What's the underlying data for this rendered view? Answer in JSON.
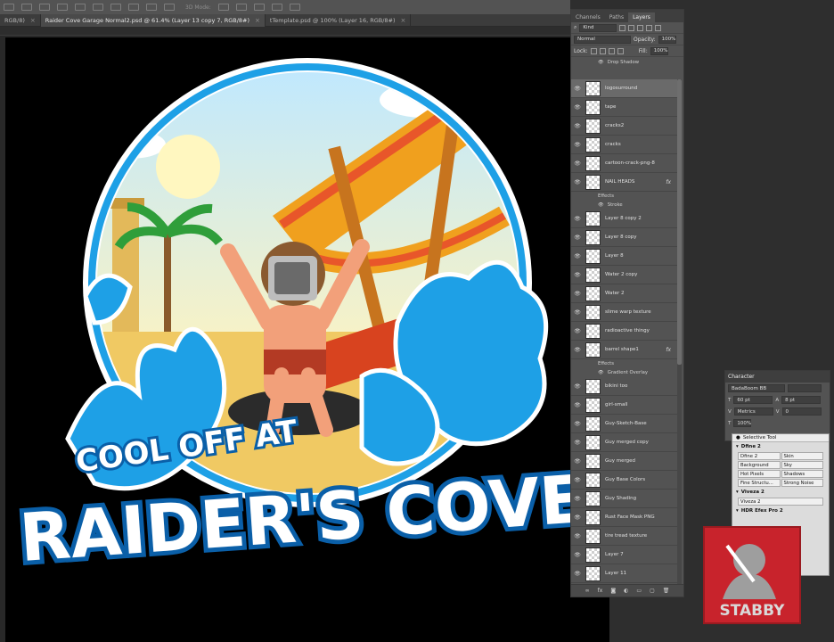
{
  "options_bar": {
    "mode_3d": "3D Mode:"
  },
  "tabs": [
    {
      "label": "RGB/8)",
      "active": false
    },
    {
      "label": "Raider Cove Garage Normal2.psd @ 61.4% (Layer 13 copy 7, RGB/8#)",
      "active": true
    },
    {
      "label": "tTemplate.psd @ 100% (Layer 16, RGB/8#)",
      "active": false
    }
  ],
  "artwork": {
    "line1": "COOL OFF AT",
    "line2": "RAIDER'S COVE"
  },
  "layers_panel": {
    "tabs": [
      "Channels",
      "Paths",
      "Layers"
    ],
    "filter": "Kind",
    "blend_mode": "Normal",
    "opacity_label": "Opacity:",
    "opacity": "100%",
    "lock_label": "Lock:",
    "fill_label": "Fill:",
    "fill": "100%",
    "top_effect": "Drop Shadow",
    "layers": [
      {
        "name": "logosurround",
        "selected": true,
        "fx": false
      },
      {
        "name": "tape",
        "fx": false
      },
      {
        "name": "cracks2",
        "fx": false
      },
      {
        "name": "cracks",
        "fx": false
      },
      {
        "name": "cartoon-crack-png-8",
        "fx": false
      },
      {
        "name": "NAIL HEADS",
        "fx": true,
        "effects": [
          "Effects",
          "Stroke"
        ]
      },
      {
        "name": "Layer 8 copy 2",
        "fx": false
      },
      {
        "name": "Layer 8 copy",
        "fx": false
      },
      {
        "name": "Layer 8",
        "fx": false
      },
      {
        "name": "Water 2 copy",
        "fx": false
      },
      {
        "name": "Water 2",
        "fx": false
      },
      {
        "name": "slime warp texture",
        "fx": false
      },
      {
        "name": "radioactive thingy",
        "fx": false
      },
      {
        "name": "barrel shape1",
        "fx": true,
        "effects": [
          "Effects",
          "Gradient Overlay"
        ]
      },
      {
        "name": "bikini too",
        "fx": false
      },
      {
        "name": "girl-small",
        "fx": false
      },
      {
        "name": "Guy-Sketch-Base",
        "fx": false
      },
      {
        "name": "Guy merged copy",
        "fx": false
      },
      {
        "name": "Guy merged",
        "fx": false
      },
      {
        "name": "Guy Base Colors",
        "fx": false
      },
      {
        "name": "Guy Shading",
        "fx": false
      },
      {
        "name": "Rust Face Mask PNG",
        "fx": false
      },
      {
        "name": "tire tread texture",
        "fx": false
      },
      {
        "name": "Layer 7",
        "fx": false
      },
      {
        "name": "Layer 11",
        "fx": false
      }
    ],
    "fx_label": "fx"
  },
  "character_panel": {
    "title": "Character",
    "font": "BadaBoom BB",
    "size": "60 pt",
    "leading": "8 pt",
    "kerning": "Metrics",
    "tracking": "0",
    "scale_v": "100%"
  },
  "selective_tool": {
    "title": "Selective Tool",
    "sections": [
      {
        "name": "Dfine 2",
        "buttons": [
          "Dfine 2",
          "Skin",
          "Background",
          "Sky",
          "Hot Pixels",
          "Shadows",
          "Fine Structu...",
          "Strong Noise"
        ]
      },
      {
        "name": "Viveza 2",
        "buttons": [
          "Viveza 2"
        ]
      },
      {
        "name": "HDR Efex Pro 2",
        "buttons": []
      }
    ]
  },
  "logo": {
    "text": "STABBY"
  },
  "colors": {
    "splash_blue": "#1ea0e6",
    "dark_blue": "#0a5fa8",
    "stabby_red": "#c8232c"
  }
}
